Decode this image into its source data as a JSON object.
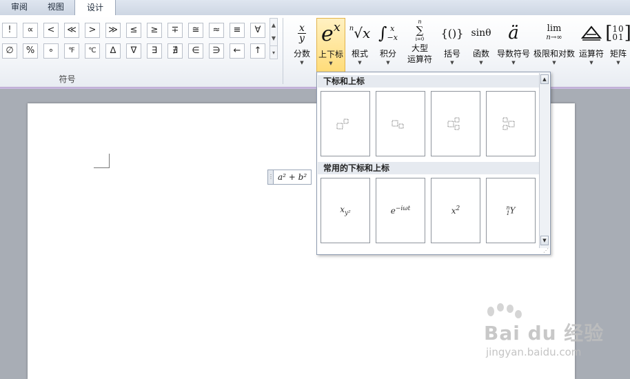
{
  "tabs": [
    {
      "label": "审阅",
      "active": false
    },
    {
      "label": "视图",
      "active": false
    },
    {
      "label": "设计",
      "active": true
    }
  ],
  "symbols": {
    "row1": [
      "!",
      "∝",
      "<",
      "≪",
      ">",
      "≫",
      "≤",
      "≥",
      "∓",
      "≅",
      "≈",
      "≡",
      "∀"
    ],
    "row2": [
      "∅",
      "%",
      "∘",
      "℉",
      "℃",
      "∆",
      "∇",
      "∃",
      "∄",
      "∈",
      "∋",
      "←",
      "↑"
    ],
    "group_label": "符号",
    "scroll_up": "▲",
    "scroll_down": "▼",
    "scroll_more": "▾"
  },
  "structures": [
    {
      "label": "分数",
      "glyph": "fraction-icon"
    },
    {
      "label": "上下标",
      "glyph": "script-icon",
      "selected": true
    },
    {
      "label": "根式",
      "glyph": "radical-icon"
    },
    {
      "label": "积分",
      "glyph": "integral-icon"
    },
    {
      "label": "大型",
      "label2": "运算符",
      "glyph": "large-operator-icon"
    },
    {
      "label": "括号",
      "glyph": "bracket-icon"
    },
    {
      "label": "函数",
      "glyph": "function-icon",
      "text": "sinθ"
    },
    {
      "label": "导数符号",
      "glyph": "accent-icon",
      "text": "ä"
    },
    {
      "label": "极限和对数",
      "glyph": "limit-icon",
      "text": "lim",
      "text2": "n→∞"
    },
    {
      "label": "运算符",
      "glyph": "operator-icon"
    },
    {
      "label": "矩阵",
      "glyph": "matrix-icon"
    }
  ],
  "glyph_text": {
    "fraction_num": "x",
    "fraction_den": "y",
    "script_base": "e",
    "script_sup": "x",
    "radical_index": "n",
    "radical_body": "√x",
    "integral_sign": "∫",
    "integral_upper": "x",
    "integral_lower": "−x",
    "sum_upper": "n",
    "sum_sign": "∑",
    "sum_lower": "i=0",
    "bracket": "{()}",
    "matrix_top": "10",
    "matrix_bottom": "01"
  },
  "equation": {
    "handle": "⋮",
    "text": "a² + b²"
  },
  "gallery": {
    "section1": "下标和上标",
    "section2": "常用的下标和上标",
    "common": [
      {
        "name": "x-sub-y-squared",
        "text": "x_y²"
      },
      {
        "name": "e-minus-i-omega-t",
        "text": "e^{−iωt}"
      },
      {
        "name": "x-squared",
        "text": "x²"
      },
      {
        "name": "n-1-Y",
        "text": "ⁿ₁Y"
      }
    ],
    "common_display": [
      "x",
      "y²",
      "e",
      "−iωt",
      "x",
      "2",
      "n",
      "1",
      "Y"
    ],
    "scroll_up": "▲",
    "scroll_down": "▼",
    "grip": "⋰"
  },
  "watermark": {
    "brand": "Bai du 经验",
    "url": "jingyan.baidu.com"
  }
}
